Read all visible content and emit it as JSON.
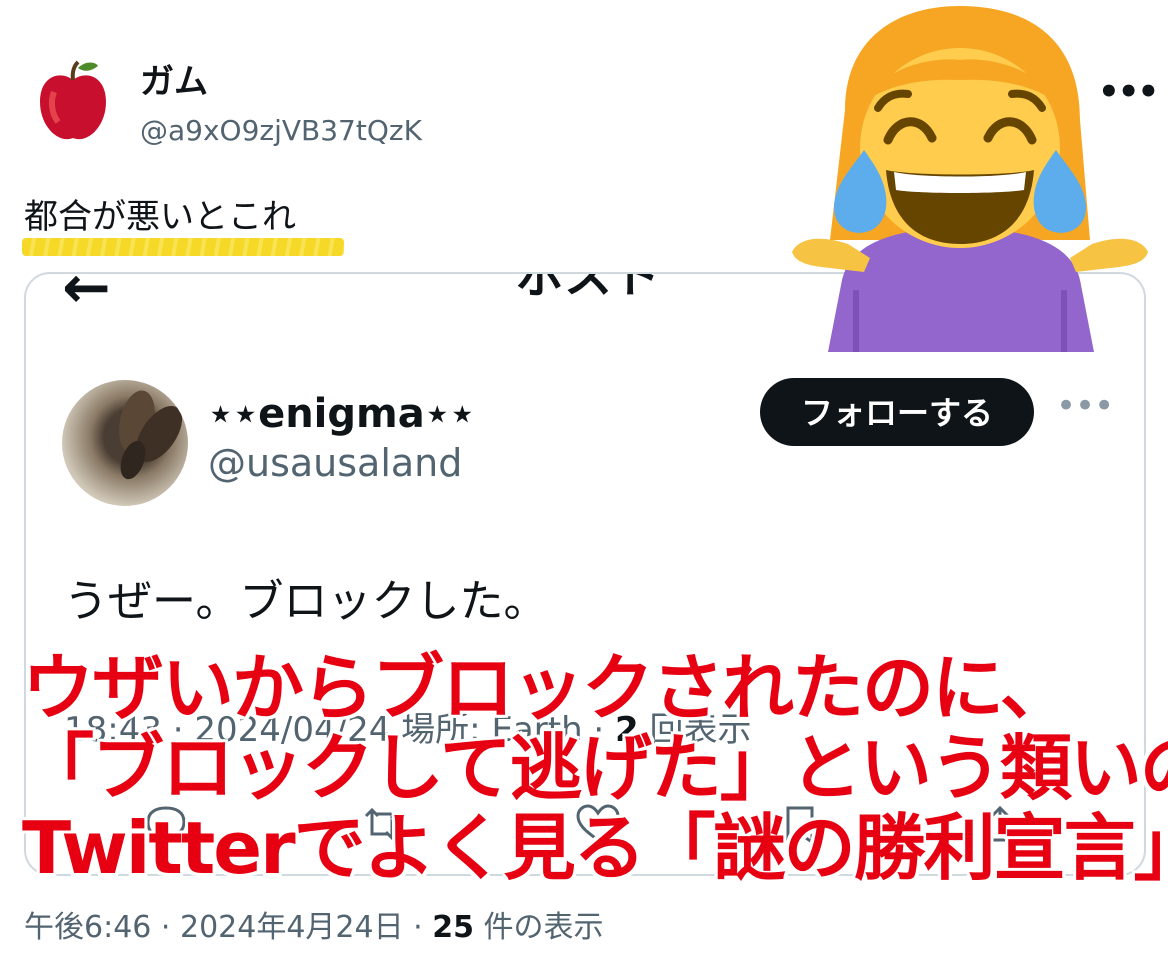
{
  "post": {
    "display_name": "ガム",
    "handle": "@a9xO9zjVB37tQzK",
    "more_icon": "more-horizontal-icon",
    "text": "都合が悪いとこれ",
    "highlight_color": "#f6d61c",
    "footer": {
      "time_date": "午後6:46 · 2024年4月24日 · ",
      "views_count": "25",
      "views_label": " 件の表示"
    }
  },
  "quoted_screenshot": {
    "topbar_title": "ポスト",
    "back_icon": "arrow-left-icon",
    "user": {
      "display_name": "⋆⋆enigma⋆⋆",
      "handle": "@usausaland",
      "follow_label": "フォローする"
    },
    "body_text": "うぜー。ブロックした。",
    "meta": {
      "time_date_place": "18:43 · 2024/04/24 場所: Earth · ",
      "views_count": "2",
      "views_label": " 回表示"
    },
    "actions": [
      "reply-icon",
      "retweet-icon",
      "like-icon",
      "bookmark-icon",
      "share-icon"
    ]
  },
  "overlay_caption": {
    "color": "#e60012",
    "lines": [
      "ウザいからブロックされたのに、",
      "「ブロックして逃げた」という類いの",
      "Twitterでよく見る「謎の勝利宣言」"
    ]
  },
  "emoji_sticker": {
    "icon": "laughing-shrug-woman-emoji"
  }
}
